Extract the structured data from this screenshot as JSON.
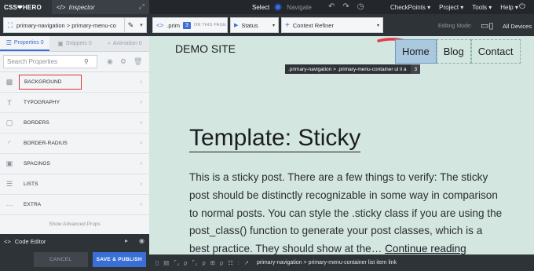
{
  "app": {
    "brand": "CSS❤HERO",
    "inspector_tab": "Inspector",
    "expand_icon": "expand-icon"
  },
  "topbar": {
    "select_label": "Select",
    "navigate_label": "Navigate",
    "menus": [
      "CheckPoints ▾",
      "Project ▾",
      "Tools ▾",
      "Help ▾"
    ]
  },
  "toolbar": {
    "selector": "primary-navigation > primary-menu-co",
    "prim_text": ".prim",
    "prim_count": "3",
    "on_this_page": "ON THIS PAGE",
    "status_label": "Status",
    "refiner_label": "Context Refiner",
    "editing_mode": "Editing Mode:",
    "all_devices": "All Devices"
  },
  "panel": {
    "tabs": [
      {
        "label": "Properties 0",
        "icon": "sliders-icon"
      },
      {
        "label": "Snippets 0",
        "icon": "snippets-icon"
      },
      {
        "label": "Animation 0",
        "icon": "animation-icon"
      }
    ],
    "search_placeholder": "Search Properties",
    "properties": [
      {
        "label": "BACKGROUND",
        "icon": "background-icon"
      },
      {
        "label": "TYPOGRAPHY",
        "icon": "typography-icon"
      },
      {
        "label": "BORDERS",
        "icon": "borders-icon"
      },
      {
        "label": "BORDER-RADIUS",
        "icon": "border-radius-icon"
      },
      {
        "label": "SPACINGS",
        "icon": "spacings-icon"
      },
      {
        "label": "LISTS",
        "icon": "lists-icon"
      },
      {
        "label": "EXTRA",
        "icon": "extra-icon"
      }
    ],
    "show_advanced": "Show Advanced Props",
    "code_editor": "Code Editor",
    "cancel": "CANCEL",
    "save": "SAVE & PUBLISH"
  },
  "preview": {
    "site_title": "DEMO SITE",
    "nav": [
      "Home",
      "Blog",
      "Contact"
    ],
    "tooltip_path": ".primary-navigation > .primary-menu-container ul li a",
    "tooltip_count": "3",
    "post_title": "Template: Sticky",
    "post_body": "This is a sticky post. There are a few things to verify: The sticky post should be distinctly recognizable in some way in comparison to normal posts. You can style the .sticky class if you are using the post_class() function to generate your post classes, which is a best practice. They should show at the… ",
    "continue_reading": "Continue reading"
  },
  "crumb": {
    "items": [
      "p",
      "p",
      "p"
    ],
    "path": "primary-navigation > primary-menu-container list item link"
  },
  "colors": {
    "accent": "#3b6fd8",
    "highlight": "#d6343a",
    "preview_bg": "#d3e6e0",
    "arrow": "#e8394a"
  }
}
